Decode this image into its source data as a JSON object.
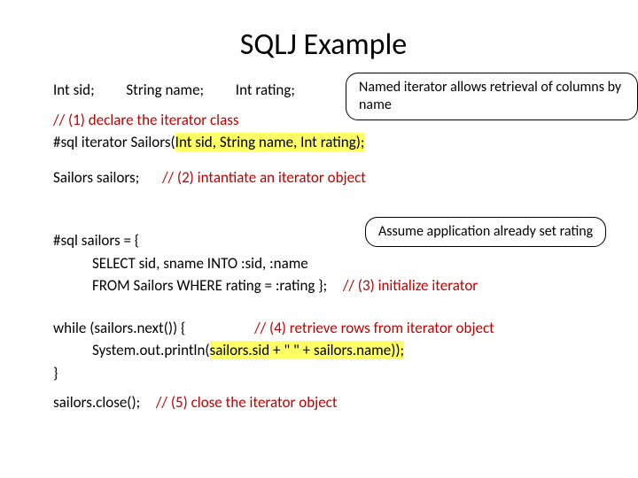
{
  "title": "SQLJ Example",
  "callouts": {
    "named_iterator": "Named iterator allows retrieval of columns by name",
    "assume_rating": "Assume application already set rating"
  },
  "line_fields": {
    "f1": "Int sid;",
    "f2": "String name;",
    "f3": "Int rating;"
  },
  "comments": {
    "c1": "// (1) declare the iterator class",
    "c2": "// (2) intantiate an iterator object",
    "c3": "// (3) initialize iterator",
    "c4": "// (4) retrieve rows from iterator object",
    "c5": "// (5) close the iterator object"
  },
  "code": {
    "decl_prefix": "#sql iterator Sailors(",
    "decl_args": "Int sid, String name, Int rating);",
    "sailors_var": "Sailors sailors;",
    "assign": "#sql   sailors = {",
    "select": "SELECT sid, sname INTO :sid, :name",
    "from": "FROM Sailors WHERE rating = :rating  };",
    "while_open": "while (sailors.next()) {",
    "println_left": "System.out.println(",
    "println_hl": "sailors.sid + \" \" + sailors.name));",
    "close_brace": "}",
    "close_call": "sailors.close();"
  }
}
